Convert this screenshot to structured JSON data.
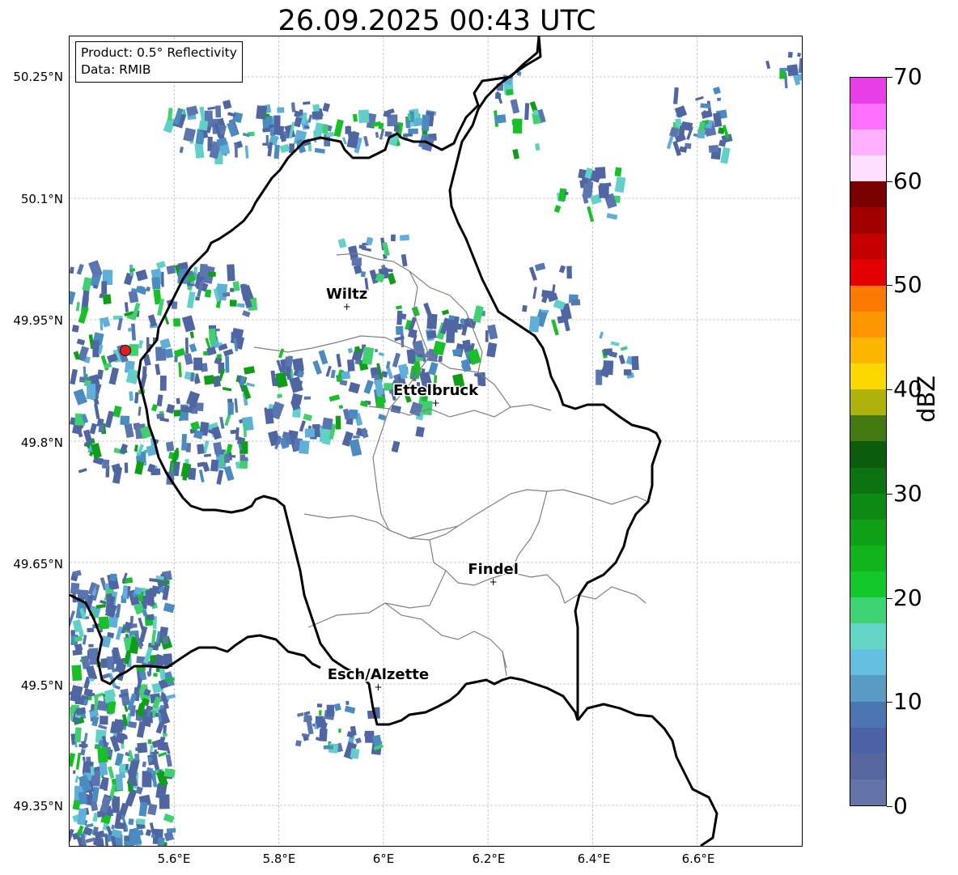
{
  "title": "26.09.2025 00:43 UTC",
  "info": {
    "product": "Product: 0.5° Reflectivity",
    "data": "Data: RMIB"
  },
  "lat_axis": [
    "50.25°N",
    "50.1°N",
    "49.95°N",
    "49.8°N",
    "49.65°N",
    "49.5°N",
    "49.35°N"
  ],
  "lon_axis": [
    "5.6°E",
    "5.8°E",
    "6°E",
    "6.2°E",
    "6.4°E",
    "6.6°E"
  ],
  "cities": [
    {
      "name": "Wiltz",
      "lon": 5.93,
      "lat": 49.966
    },
    {
      "name": "Ettelbruck",
      "lon": 6.1,
      "lat": 49.847
    },
    {
      "name": "Findel",
      "lon": 6.21,
      "lat": 49.626
    },
    {
      "name": "Esch/Alzette",
      "lon": 5.99,
      "lat": 49.496
    }
  ],
  "radar_site": {
    "lon": 5.505,
    "lat": 49.914
  },
  "colorbar": {
    "unit": "dBZ",
    "ticks": [
      "0",
      "10",
      "20",
      "30",
      "40",
      "50",
      "60",
      "70"
    ],
    "colors": [
      "#6574a8",
      "#5667a0",
      "#4b62a4",
      "#4a75b0",
      "#5a9bc6",
      "#64bfe0",
      "#63d5c4",
      "#3ed474",
      "#12c82a",
      "#10b41c",
      "#10a018",
      "#0d8a14",
      "#0b7410",
      "#0c5c0e",
      "#447810",
      "#afb20a",
      "#fdd800",
      "#fdb600",
      "#fd9600",
      "#fd7a00",
      "#e40000",
      "#c40000",
      "#a20000",
      "#7a0000",
      "#ffe0ff",
      "#ffb0ff",
      "#ff70ff",
      "#e83ee8"
    ]
  },
  "chart_data": {
    "type": "map",
    "title": "26.09.2025 00:43 UTC",
    "extent": {
      "lon": [
        5.4,
        6.8
      ],
      "lat": [
        49.3,
        50.3
      ]
    },
    "xticks": [
      "5.6°E",
      "5.8°E",
      "6°E",
      "6.2°E",
      "6.4°E",
      "6.6°E"
    ],
    "yticks": [
      "50.25°N",
      "50.1°N",
      "49.95°N",
      "49.8°N",
      "49.65°N",
      "49.5°N",
      "49.35°N"
    ],
    "grid": true,
    "colorbar_range": [
      0,
      70
    ],
    "colorbar_unit": "dBZ"
  }
}
